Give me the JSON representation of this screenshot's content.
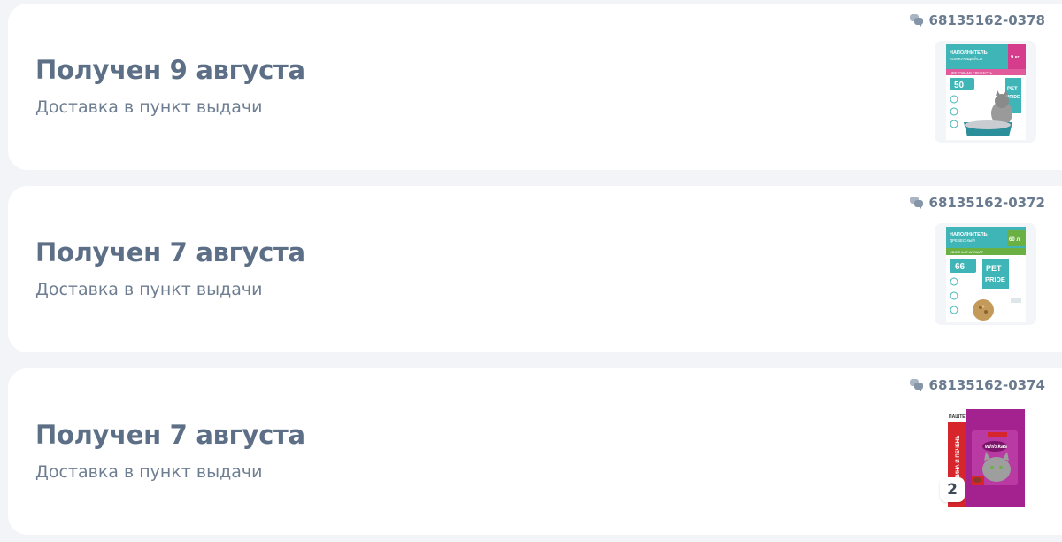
{
  "orders": [
    {
      "order_number": "68135162-0378",
      "status": "Получен 9 августа",
      "delivery": "Доставка в пункт выдачи",
      "product_image": "pet-pride-clumping-litter-package",
      "image_text": {
        "line1": "НАПОЛНИТЕЛЬ",
        "line2": "КОМКУЮЩИЙСЯ",
        "weight": "9 кг",
        "scent": "ЦВЕТОЧНАЯ СВЕЖЕСТЬ",
        "days": "50",
        "brand1": "PET",
        "brand2": "PRIDE"
      }
    },
    {
      "order_number": "68135162-0372",
      "status": "Получен 7 августа",
      "delivery": "Доставка в пункт выдачи",
      "product_image": "pet-pride-wood-litter-package",
      "image_text": {
        "line1": "НАПОЛНИТЕЛЬ",
        "line2": "ДРЕВЕСНЫЙ",
        "weight": "60 л",
        "scent": "ХВОЙНЫЙ АРОМАТ",
        "days": "66",
        "brand1": "PET",
        "brand2": "PRIDE"
      }
    },
    {
      "order_number": "68135162-0374",
      "status": "Получен 7 августа",
      "delivery": "Доставка в пункт выдачи",
      "product_image": "whiskas-pouch-package",
      "quantity": "2",
      "image_text": {
        "type": "ПАШТЕТ",
        "flavor": "ГОВЯДИНА И ПЕЧЕНЬ",
        "brand": "whiskas"
      }
    }
  ],
  "colors": {
    "page_bg": "#f2f4f8",
    "card_bg": "#ffffff",
    "title": "#5c6f86",
    "subtitle": "#6e7e92",
    "order_id": "#6b7b8f",
    "teal": "#3fb5b7",
    "pink": "#d63c8c",
    "green": "#6bb043",
    "whiskas_purple": "#a4228f",
    "whiskas_red": "#d7262b"
  }
}
